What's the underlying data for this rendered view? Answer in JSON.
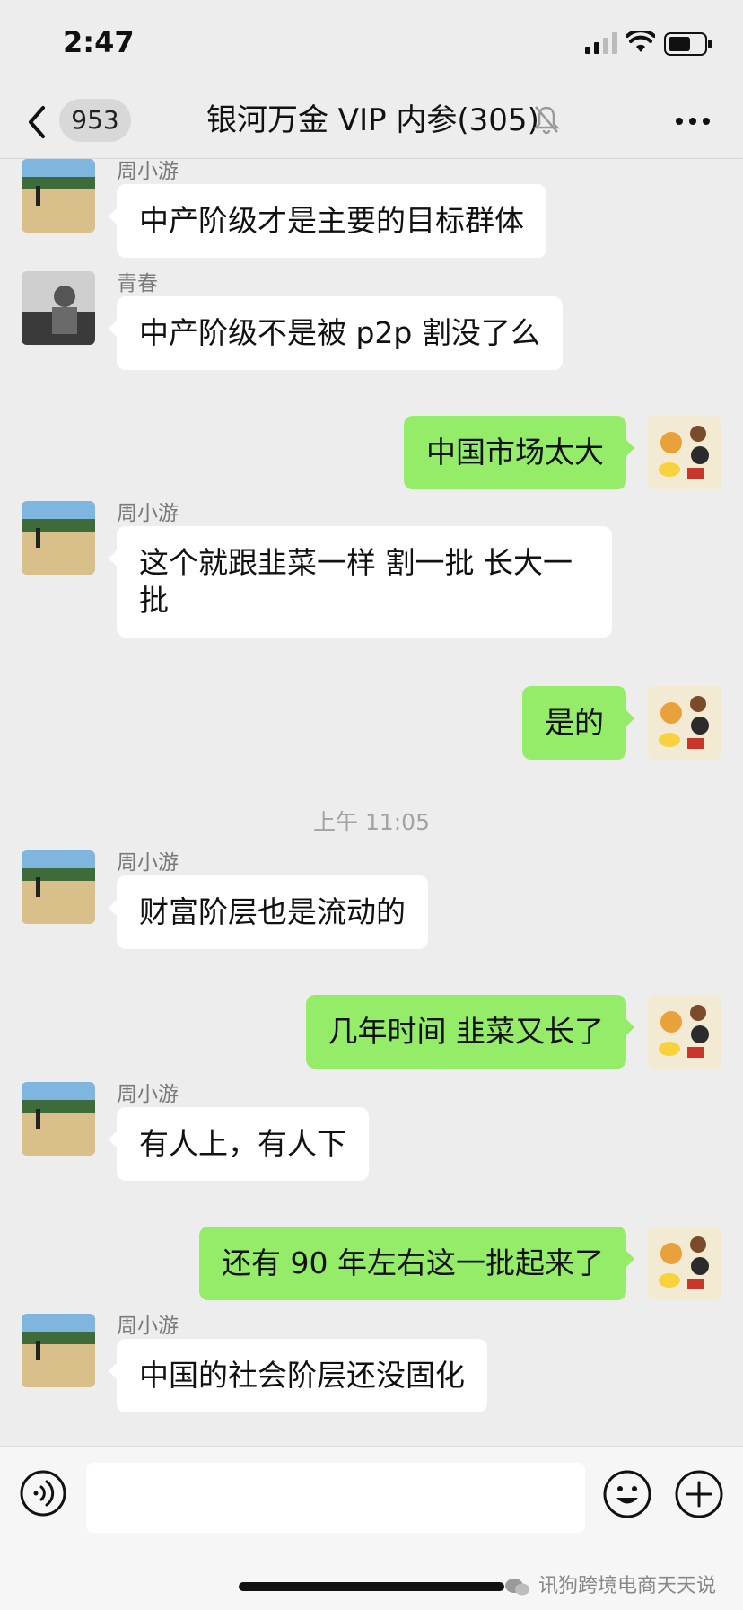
{
  "status_bar": {
    "time": "2:47"
  },
  "nav": {
    "unread_count": "953",
    "title": "银河万金 VIP 内参(305)"
  },
  "messages": [
    {
      "sender": "周小游",
      "text": "中产阶级才是主要的目标群体"
    },
    {
      "sender": "青春",
      "text": "中产阶级不是被 p2p 割没了么"
    },
    {
      "text": "中国市场太大"
    },
    {
      "sender": "周小游",
      "text": "这个就跟韭菜一样 割一批 长大一批"
    },
    {
      "text": "是的"
    },
    {
      "timestamp": "上午 11:05"
    },
    {
      "sender": "周小游",
      "text": "财富阶层也是流动的"
    },
    {
      "text": "几年时间 韭菜又长了"
    },
    {
      "sender": "周小游",
      "text": "有人上，有人下"
    },
    {
      "text": "还有 90 年左右这一批起来了"
    },
    {
      "sender": "周小游",
      "text": "中国的社会阶层还没固化"
    }
  ],
  "input": {
    "value": "",
    "placeholder": ""
  },
  "watermark": "讯狗跨境电商天天说",
  "icons": {
    "back": "chevron-left-icon",
    "mute": "bell-muted-icon",
    "more": "more-dots-icon",
    "voice": "voice-icon",
    "emoji": "emoji-icon",
    "plus": "plus-icon"
  },
  "colors": {
    "background": "#ededed",
    "outgoing_bubble": "#95ec69",
    "incoming_bubble": "#ffffff"
  }
}
